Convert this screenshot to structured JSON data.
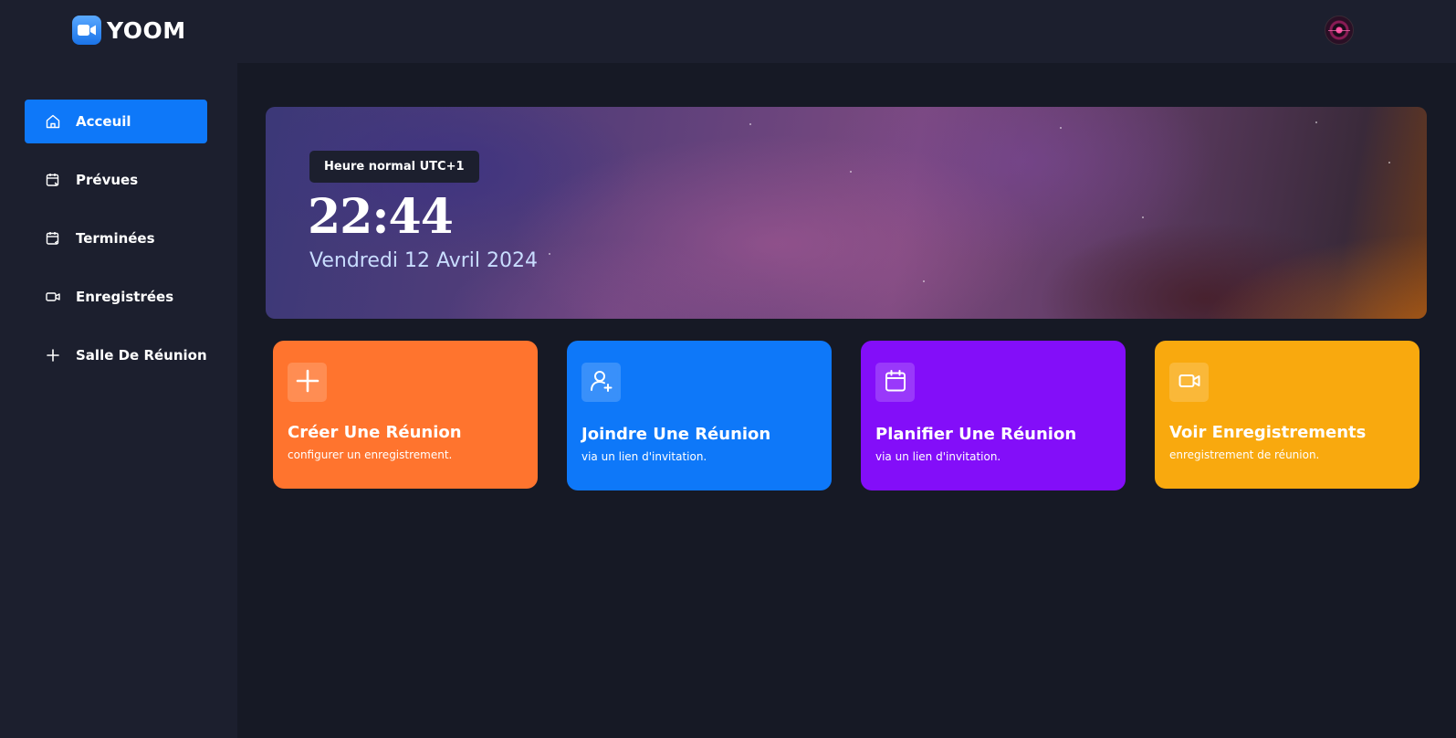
{
  "app": {
    "name": "YOOM"
  },
  "sidebar": {
    "items": [
      {
        "label": "Acceuil",
        "icon": "home-icon",
        "active": true
      },
      {
        "label": "Prévues",
        "icon": "calendar-upcoming-icon",
        "active": false
      },
      {
        "label": "Terminées",
        "icon": "calendar-previous-icon",
        "active": false
      },
      {
        "label": "Enregistrées",
        "icon": "video-icon",
        "active": false
      },
      {
        "label": "Salle De Réunion",
        "icon": "plus-icon",
        "active": false
      }
    ]
  },
  "hero": {
    "timezone": "Heure normal UTC+1",
    "time": "22:44",
    "date": "Vendredi 12 Avril 2024"
  },
  "cards": [
    {
      "title": "Créer Une Réunion",
      "subtitle": "configurer un enregistrement.",
      "icon": "plus-icon",
      "color": "#ff742e"
    },
    {
      "title": "Joindre Une Réunion",
      "subtitle": "via un lien d'invitation.",
      "icon": "add-user-icon",
      "color": "#0e78f9"
    },
    {
      "title": "Planifier Une Réunion",
      "subtitle": "via un lien d'invitation.",
      "icon": "calendar-icon",
      "color": "#830ef9"
    },
    {
      "title": "Voir Enregistrements",
      "subtitle": "enregistrement de réunion.",
      "icon": "video-icon",
      "color": "#f9a90e"
    }
  ],
  "colors": {
    "accent": "#0e78f9",
    "sidebar_bg": "#1c1f2e",
    "main_bg": "#161925"
  }
}
